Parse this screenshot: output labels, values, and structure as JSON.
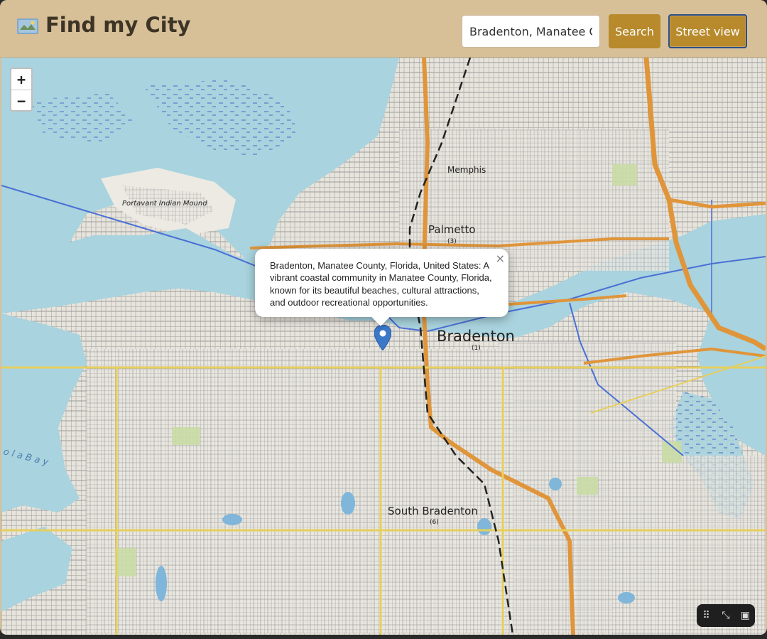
{
  "header": {
    "title": "Find my City",
    "logo_icon": "map-icon",
    "search_value": "Bradenton, Manatee Co",
    "search_button": "Search",
    "street_view_button": "Street view"
  },
  "map": {
    "zoom_in": "+",
    "zoom_out": "−",
    "labels": {
      "memphis": "Memphis",
      "portavant": "Portavant Indian Mound",
      "palmetto": "Palmetto",
      "palmetto_num": "(3)",
      "bradenton": "Bradenton",
      "bradenton_num": "(1)",
      "south_bradenton": "South Bradenton",
      "south_bradenton_num": "(6)",
      "bay": "o l a   B a y"
    },
    "popup": {
      "text": "Bradenton, Manatee County, Florida, United States: A vibrant coastal community in Manatee County, Florida, known for its beautiful beaches, cultural attractions, and outdoor recreational opportunities.",
      "close": "×"
    },
    "marker_icon": "map-pin-icon"
  },
  "colors": {
    "header_bg": "#d7bf98",
    "button_bg": "#b88a2c",
    "water": "#a9d3de",
    "land": "#e9e6df",
    "major_road": "#e0953a",
    "marker": "#3b78c8"
  }
}
